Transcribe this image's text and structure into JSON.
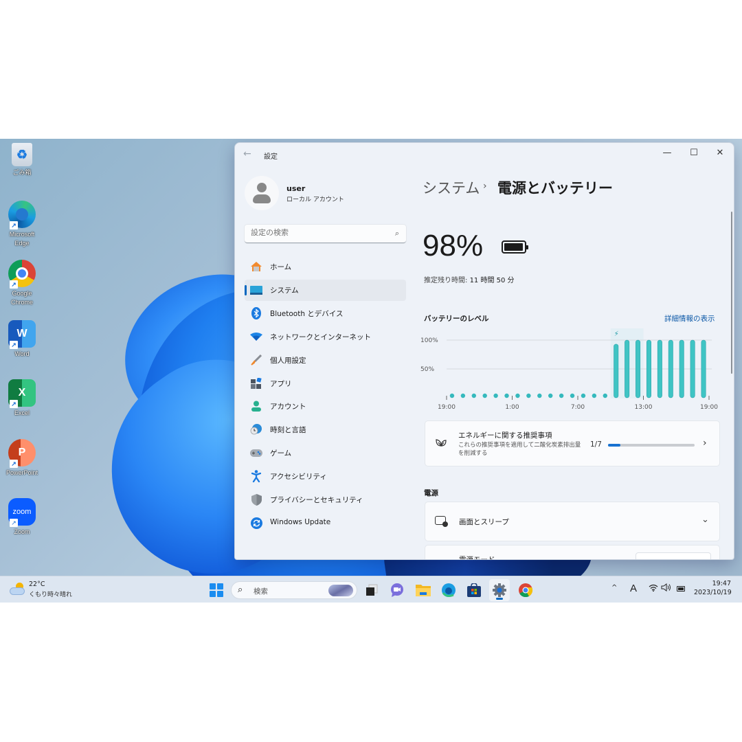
{
  "desktop": {
    "icons": [
      {
        "label": "ごみ箱",
        "icon": "recycle-bin-icon"
      },
      {
        "label": "Microsoft Edge",
        "icon": "edge-icon",
        "shortcut": true
      },
      {
        "label": "Google Chrome",
        "icon": "chrome-icon",
        "shortcut": true
      },
      {
        "label": "Word",
        "icon": "word-icon",
        "glyph": "W",
        "shortcut": true
      },
      {
        "label": "Excel",
        "icon": "excel-icon",
        "glyph": "X",
        "shortcut": true
      },
      {
        "label": "PowerPoint",
        "icon": "powerpoint-icon",
        "glyph": "P",
        "shortcut": true
      },
      {
        "label": "Zoom",
        "icon": "zoom-icon",
        "glyph": "zoom",
        "shortcut": true
      }
    ]
  },
  "window": {
    "title": "設定",
    "back_icon": "←",
    "controls": {
      "minimize": "—",
      "maximize": "☐",
      "close": "✕"
    }
  },
  "profile": {
    "name": "user",
    "account_type": "ローカル アカウント"
  },
  "search": {
    "placeholder": "設定の検索",
    "icon": "⌕"
  },
  "nav": {
    "items": [
      {
        "label": "ホーム",
        "icon": "home-icon",
        "active": false
      },
      {
        "label": "システム",
        "icon": "system-icon",
        "active": true
      },
      {
        "label": "Bluetooth とデバイス",
        "icon": "bluetooth-icon",
        "active": false
      },
      {
        "label": "ネットワークとインターネット",
        "icon": "wifi-icon",
        "active": false
      },
      {
        "label": "個人用設定",
        "icon": "brush-icon",
        "active": false
      },
      {
        "label": "アプリ",
        "icon": "apps-icon",
        "active": false
      },
      {
        "label": "アカウント",
        "icon": "account-icon",
        "active": false
      },
      {
        "label": "時刻と言語",
        "icon": "time-language-icon",
        "active": false
      },
      {
        "label": "ゲーム",
        "icon": "gamepad-icon",
        "active": false
      },
      {
        "label": "アクセシビリティ",
        "icon": "accessibility-icon",
        "active": false
      },
      {
        "label": "プライバシーとセキュリティ",
        "icon": "shield-icon",
        "active": false
      },
      {
        "label": "Windows Update",
        "icon": "windows-update-icon",
        "active": false
      }
    ]
  },
  "content": {
    "breadcrumb": {
      "parent": "システム",
      "separator": "›",
      "current": "電源とバッテリー"
    },
    "battery_percent": "98%",
    "battery_fraction": 0.98,
    "remaining_label": "推定残り時間:",
    "remaining_value": "11 時間 50 分",
    "level_title": "バッテリーのレベル",
    "details_link": "詳細情報の表示",
    "energy": {
      "title": "エネルギーに関する推奨事項",
      "description": "これらの推奨事項を適用して二酸化炭素排出量を削減する",
      "count": "1/7",
      "progress": 0.142857,
      "chevron": "›"
    },
    "power_heading": "電源",
    "sleep_label": "画面とスリープ",
    "sleep_chevron": "⌄",
    "power_mode_label": "電源モード"
  },
  "chart_data": {
    "type": "bar",
    "title": "バッテリーのレベル",
    "xlabel": "",
    "ylabel": "",
    "ylim": [
      0,
      100
    ],
    "yticks": [
      "100%",
      "50%"
    ],
    "ytick_values": [
      100,
      50
    ],
    "xticks": [
      "19:00",
      "1:00",
      "7:00",
      "13:00",
      "19:00"
    ],
    "xtick_hours_offset": [
      0,
      6,
      12,
      18,
      24
    ],
    "grid": true,
    "hours": [
      "19:00",
      "20:00",
      "21:00",
      "22:00",
      "23:00",
      "0:00",
      "1:00",
      "2:00",
      "3:00",
      "4:00",
      "5:00",
      "6:00",
      "7:00",
      "8:00",
      "9:00",
      "10:00",
      "11:00",
      "12:00",
      "13:00",
      "14:00",
      "15:00",
      "16:00",
      "17:00",
      "18:00"
    ],
    "values": [
      null,
      null,
      null,
      null,
      null,
      null,
      null,
      null,
      null,
      null,
      null,
      null,
      null,
      null,
      null,
      93,
      100,
      100,
      100,
      100,
      100,
      100,
      100,
      100
    ],
    "no_data_marker": "dot",
    "charging_hours": [
      "10:00",
      "11:00",
      "12:00"
    ],
    "charging_icon": "⚡",
    "bar_color": "#3fc4c4"
  },
  "taskbar": {
    "weather": {
      "temp": "22°C",
      "condition": "くもり時々晴れ"
    },
    "search_label": "検索",
    "apps": [
      {
        "name": "task-view",
        "active": false
      },
      {
        "name": "teams-chat",
        "active": false
      },
      {
        "name": "file-explorer",
        "active": false
      },
      {
        "name": "edge",
        "active": false
      },
      {
        "name": "microsoft-store",
        "active": false
      },
      {
        "name": "settings",
        "active": true
      },
      {
        "name": "chrome",
        "active": false
      }
    ],
    "tray": {
      "chevron": "^",
      "ime": "A",
      "wifi": "wifi",
      "volume": "volume",
      "battery": "battery"
    },
    "time": "19:47",
    "date": "2023/10/19"
  }
}
